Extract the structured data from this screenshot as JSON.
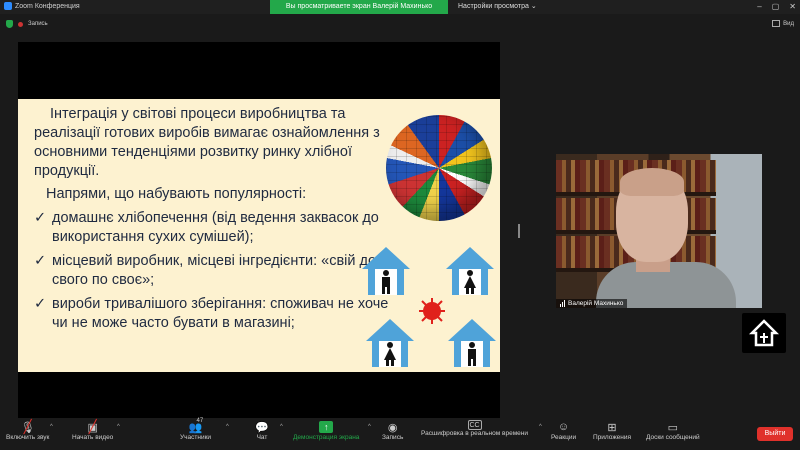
{
  "window": {
    "app_title": "Zoom Конференция",
    "share_banner": "Вы просматриваете экран Валерій Махинько",
    "view_options": "Настройки просмотра"
  },
  "topbar": {
    "recording_label": "Запись",
    "view_label": "Вид"
  },
  "slide": {
    "intro": "Інтеграція у світові процеси виробництва та реалізації готових виробів вимагає ознайомлення з основними тенденціями розвитку ринку хлібної продукції.",
    "directions_title": "Напрями, що набувають популярності:",
    "bullets": [
      "домашнє хлібопечення (від ведення заквасок до використання сухих сумішей);",
      "місцевий виробник, місцеві інгредієнти: «свій до свого по своє»;",
      "вироби тривалішого зберігання: споживач не хоче чи не може часто бувати в магазині;"
    ],
    "check_mark": "✓"
  },
  "participant": {
    "name": "Валерій Махинько"
  },
  "toolbar": {
    "mute_label": "Включить звук",
    "video_label": "Начать видео",
    "participants_label": "Участники",
    "participants_count": "47",
    "chat_label": "Чат",
    "share_label": "Демонстрация экрана",
    "record_label": "Запись",
    "cc_label": "Расшифровка в реальном времени",
    "reactions_label": "Реакции",
    "apps_label": "Приложения",
    "whiteboard_label": "Доски сообщений",
    "leave_label": "Выйти"
  },
  "colors": {
    "share_green": "#23a84a",
    "leave_red": "#e0312b",
    "slide_bg": "#fdf2d0",
    "house_blue": "#4fa3d9",
    "virus_red": "#e0211b"
  }
}
